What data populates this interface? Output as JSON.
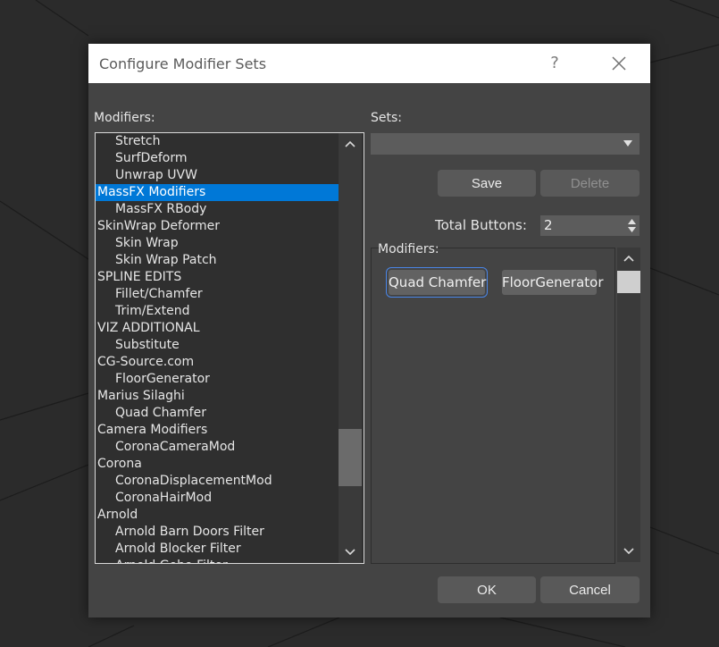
{
  "dialog": {
    "title": "Configure Modifier Sets",
    "help_label": "?"
  },
  "modifiers_list": {
    "label": "Modifiers:",
    "items": [
      {
        "text": "Stretch",
        "child": true
      },
      {
        "text": "SurfDeform",
        "child": true
      },
      {
        "text": "Unwrap UVW",
        "child": true
      },
      {
        "text": "MassFX Modifiers",
        "child": false,
        "selected": true
      },
      {
        "text": "MassFX RBody",
        "child": true
      },
      {
        "text": "SkinWrap Deformer",
        "child": false
      },
      {
        "text": "Skin Wrap",
        "child": true
      },
      {
        "text": "Skin Wrap Patch",
        "child": true
      },
      {
        "text": "SPLINE EDITS",
        "child": false
      },
      {
        "text": "Fillet/Chamfer",
        "child": true
      },
      {
        "text": "Trim/Extend",
        "child": true
      },
      {
        "text": "VIZ ADDITIONAL",
        "child": false
      },
      {
        "text": "Substitute",
        "child": true
      },
      {
        "text": "CG-Source.com",
        "child": false
      },
      {
        "text": "FloorGenerator",
        "child": true
      },
      {
        "text": "Marius Silaghi",
        "child": false
      },
      {
        "text": "Quad Chamfer",
        "child": true
      },
      {
        "text": "Camera Modifiers",
        "child": false
      },
      {
        "text": "CoronaCameraMod",
        "child": true
      },
      {
        "text": "Corona",
        "child": false
      },
      {
        "text": "CoronaDisplacementMod",
        "child": true
      },
      {
        "text": "CoronaHairMod",
        "child": true
      },
      {
        "text": "Arnold",
        "child": false
      },
      {
        "text": "Arnold Barn Doors Filter",
        "child": true
      },
      {
        "text": "Arnold Blocker Filter",
        "child": true
      },
      {
        "text": "Arnold Gobo Filter",
        "child": true
      }
    ],
    "scroll_position": 0.8
  },
  "sets": {
    "label": "Sets:",
    "selected_value": "",
    "save_label": "Save",
    "delete_label": "Delete",
    "total_buttons_label": "Total Buttons:",
    "total_buttons_value": "2"
  },
  "modifier_buttons": {
    "label": "Modifiers:",
    "buttons": [
      "Quad Chamfer",
      "FloorGenerator"
    ]
  },
  "footer": {
    "ok_label": "OK",
    "cancel_label": "Cancel"
  },
  "colors": {
    "selection": "#0078d7",
    "dialog_bg": "#444444",
    "focus_outline": "#4a86e8"
  }
}
